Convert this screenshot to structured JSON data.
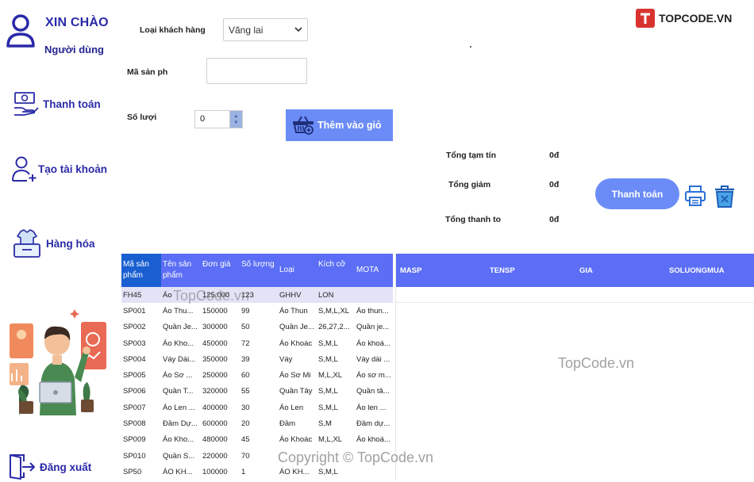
{
  "sidebar": {
    "greeting": "XIN CHÀO",
    "user": "Người dùng",
    "items": [
      {
        "label": "Thanh toán",
        "icon": "money-hand-icon"
      },
      {
        "label": "Tạo tài khoản",
        "icon": "add-user-icon"
      },
      {
        "label": "Hàng hóa",
        "icon": "goods-box-icon"
      },
      {
        "label": "Đăng xuất",
        "icon": "logout-door-icon"
      }
    ]
  },
  "form": {
    "customer_type_label": "Loại khách hàng",
    "customer_type_value": "Vãng lai",
    "product_code_label": "Mã sản ph",
    "product_code_value": "",
    "quantity_label": "Số lượi",
    "quantity_value": "0",
    "add_to_cart_label": "Thêm vào giỏ"
  },
  "totals": {
    "subtotal_label": "Tổng tạm tín",
    "subtotal_value": "0đ",
    "discount_label": "Tổng giảm",
    "discount_value": "0đ",
    "total_label": "Tổng thanh to",
    "total_value": "0đ",
    "pay_label": "Thanh toán"
  },
  "products": {
    "columns": [
      "Mã sản phẩm",
      "Tên sản phẩm",
      "Đơn giá",
      "Số lượng",
      "Loại",
      "Kích cỡ",
      "MOTA"
    ],
    "rows": [
      [
        "FH45",
        "Áo",
        "125.000",
        "123",
        "GHHV",
        "LON",
        ""
      ],
      [
        "SP001",
        "Áo Thu...",
        "150000",
        "99",
        "Áo Thun",
        "S,M,L,XL",
        "Áo thun..."
      ],
      [
        "SP002",
        "Quần Je...",
        "300000",
        "50",
        "Quần Je...",
        "26,27,2...",
        "Quần je..."
      ],
      [
        "SP003",
        "Áo Kho...",
        "450000",
        "72",
        "Áo Khoác",
        "S,M,L",
        "Áo khoá..."
      ],
      [
        "SP004",
        "Váy Dài...",
        "350000",
        "39",
        "Váy",
        "S,M,L",
        "Váy dài ..."
      ],
      [
        "SP005",
        "Áo Sơ ...",
        "250000",
        "60",
        "Áo Sơ Mi",
        "M,L,XL",
        "Áo sơ m..."
      ],
      [
        "SP006",
        "Quần T...",
        "320000",
        "55",
        "Quần Tây",
        "S,M,L",
        "Quần tâ..."
      ],
      [
        "SP007",
        "Áo Len ...",
        "400000",
        "30",
        "Áo Len",
        "S,M,L",
        "Áo len ..."
      ],
      [
        "SP008",
        "Đầm Dự...",
        "600000",
        "20",
        "Đầm",
        "S,M",
        "Đầm dự..."
      ],
      [
        "SP009",
        "Áo Kho...",
        "480000",
        "45",
        "Áo Khoác",
        "M,L,XL",
        "Áo khoá..."
      ],
      [
        "SP010",
        "Quần S...",
        "220000",
        "70",
        "",
        "",
        ""
      ],
      [
        "SP50",
        "ÁO KH...",
        "100000",
        "1",
        "ÁO KH...",
        "S,M,L",
        ""
      ]
    ]
  },
  "cart": {
    "columns": [
      "MASP",
      "TENSP",
      "GIA",
      "SOLUONGMUA"
    ]
  },
  "watermarks": {
    "logo": "TOPCODE.VN",
    "mid_left": "TopCode.vn",
    "mid_right": "TopCode.vn",
    "bottom": "Copyright © TopCode.vn"
  }
}
